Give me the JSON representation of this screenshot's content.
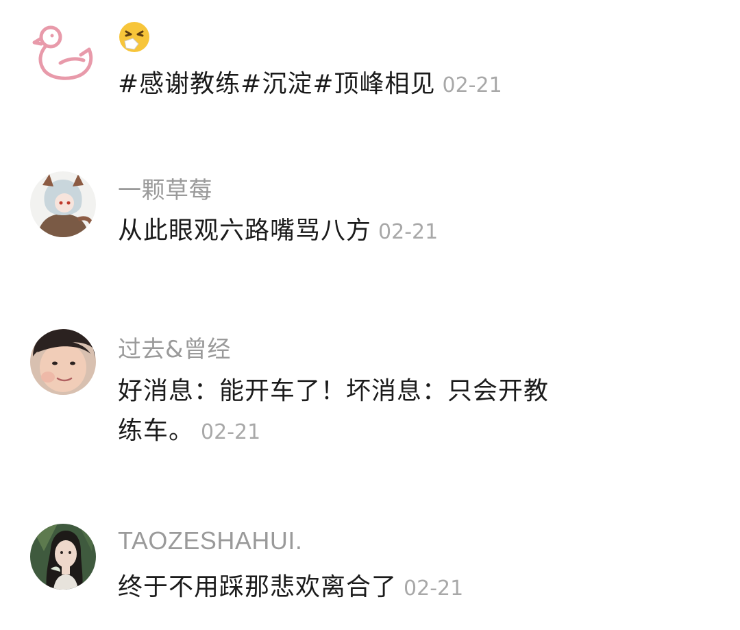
{
  "comments": [
    {
      "username": "",
      "name_emoji": "sneezing-face-icon",
      "text": "#感谢教练#沉淀#顶峰相见",
      "time": "02-21"
    },
    {
      "username": "一颗草莓",
      "text": "从此眼观六路嘴骂八方",
      "time": "02-21"
    },
    {
      "username": "过去&曾经",
      "text_line1": "好消息：能开车了！坏消息：只会开教",
      "text_line2": "练车。",
      "time": "02-21"
    },
    {
      "username": "TAOZESHAHUI.",
      "text": "终于不用踩那悲欢离合了",
      "time": "02-21"
    }
  ],
  "colors": {
    "username": "#9a9a9a",
    "text": "#1b1b1b",
    "time": "#a8a8a8",
    "background": "#ffffff"
  }
}
